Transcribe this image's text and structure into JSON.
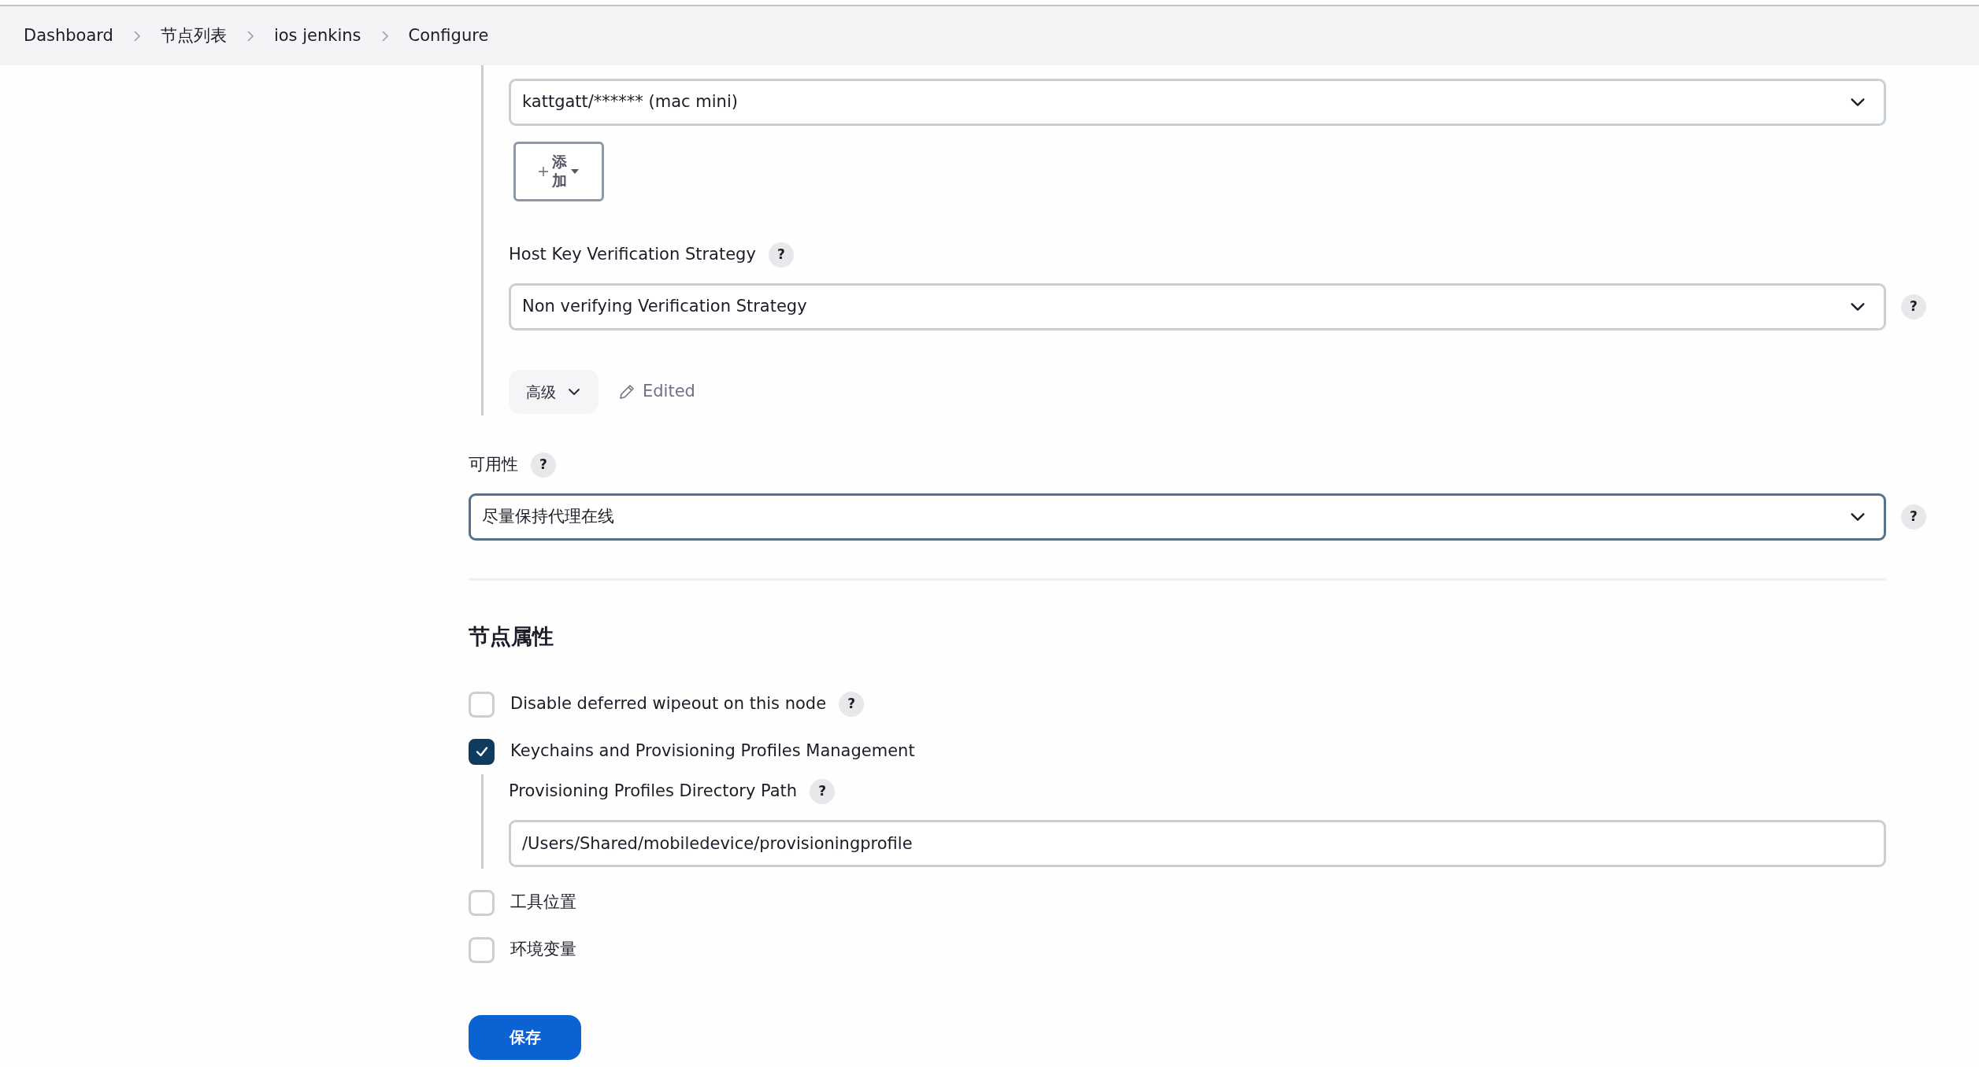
{
  "breadcrumbs": [
    {
      "label": "Dashboard"
    },
    {
      "label": "节点列表"
    },
    {
      "label": "ios jenkins"
    },
    {
      "label": "Configure"
    }
  ],
  "launch_section": {
    "credentials": {
      "value": "kattgatt/****** (mac mini)"
    },
    "add_button": {
      "label": "添加"
    },
    "host_key": {
      "label": "Host Key Verification Strategy",
      "value": "Non verifying Verification Strategy",
      "label_help": "?",
      "field_help": "?"
    },
    "advanced_button": {
      "label": "高级"
    },
    "edited_note": "Edited"
  },
  "availability": {
    "label": "可用性",
    "value": "尽量保持代理在线",
    "label_help": "?",
    "field_help": "?",
    "focused": true
  },
  "node_properties": {
    "heading": "节点属性",
    "options": [
      {
        "label": "Disable deferred wipeout on this node",
        "checked": false,
        "help": "?"
      },
      {
        "label": "Keychains and Provisioning Profiles Management",
        "checked": true,
        "fields": [
          {
            "label": "Provisioning Profiles Directory Path",
            "value": "/Users/Shared/mobiledevice/provisioningprofile",
            "help": "?"
          }
        ]
      },
      {
        "label": "工具位置",
        "checked": false
      },
      {
        "label": "环境变量",
        "checked": false
      }
    ]
  },
  "save_button": {
    "label": "保存"
  }
}
